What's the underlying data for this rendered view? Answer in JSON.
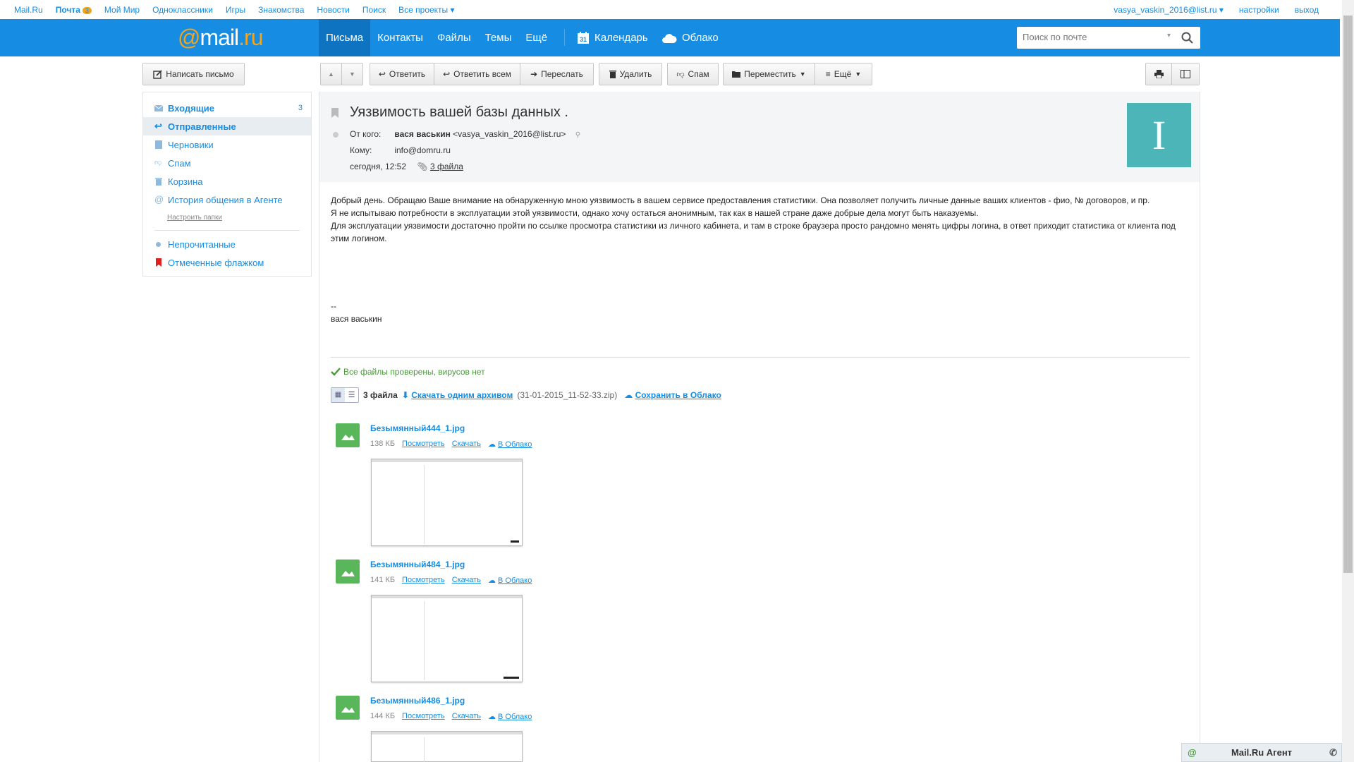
{
  "topbar": {
    "links": [
      "Mail.Ru",
      "Почта",
      "Мой Мир",
      "Одноклассники",
      "Игры",
      "Знакомства",
      "Новости",
      "Поиск",
      "Все проекты"
    ],
    "mail_count": "3",
    "user": "vasya_vaskin_2016@list.ru",
    "settings": "настройки",
    "logout": "выход"
  },
  "nav": {
    "logo_at": "@",
    "logo_mail": "mail",
    "logo_ru": ".ru",
    "tabs": [
      "Письма",
      "Контакты",
      "Файлы",
      "Темы",
      "Ещё"
    ],
    "calendar": "Календарь",
    "calendar_day": "31",
    "cloud": "Облако",
    "search_placeholder": "Поиск по почте"
  },
  "toolbar": {
    "compose": "Написать письмо",
    "reply": "Ответить",
    "reply_all": "Ответить всем",
    "forward": "Переслать",
    "delete": "Удалить",
    "spam": "Спам",
    "move": "Переместить",
    "more": "Ещё"
  },
  "sidebar": {
    "items": [
      {
        "label": "Входящие",
        "count": "3"
      },
      {
        "label": "Отправленные"
      },
      {
        "label": "Черновики"
      },
      {
        "label": "Спам"
      },
      {
        "label": "Корзина"
      },
      {
        "label": "История общения в Агенте"
      }
    ],
    "setup": "Настроить папки",
    "unread": "Непрочитанные",
    "flagged": "Отмеченные флажком"
  },
  "message": {
    "subject": "Уязвимость вашей базы данных .",
    "from_label": "От кого:",
    "from_name": "вася васькин",
    "from_email": "<vasya_vaskin_2016@list.ru>",
    "to_label": "Кому:",
    "to": "info@domru.ru",
    "date": "сегодня, 12:52",
    "files_link": "3 файла",
    "avatar_letter": "I",
    "body": [
      "Добрый день. Обращаю Ваше внимание на обнаруженную мною уязвимость в вашем сервисе предоставления статистики. Она позволяет получить личные данные ваших клиентов - фио, № договоров, и пр.",
      "Я не испытываю потребности в эксплуатации этой уязвимости, однако хочу остаться анонимным, так как в нашей стране даже добрые дела могут быть наказуемы.",
      "Для эксплуатации уязвимости достаточно пройти по ссылке просмотра статистики из личного кабинета, и там в строке браузера просто рандомно менять цифры логина, в ответ приходит статистика от клиента под этим логином."
    ],
    "sig_dash": "--",
    "signature": "вася васькин"
  },
  "attachments": {
    "virus_check": "Все файлы проверены, вирусов нет",
    "count": "3 файла",
    "download_all": "Скачать одним архивом",
    "archive_name": "(31-01-2015_11-52-33.zip)",
    "save_cloud": "Сохранить в Облако",
    "view": "Посмотреть",
    "download": "Скачать",
    "to_cloud": "В Облако",
    "files": [
      {
        "name": "Безымянный444_1.jpg",
        "size": "138 КБ"
      },
      {
        "name": "Безымянный484_1.jpg",
        "size": "141 КБ"
      },
      {
        "name": "Безымянный486_1.jpg",
        "size": "144 КБ"
      }
    ]
  },
  "agent": "Mail.Ru Агент",
  "colors": {
    "brand": "#168de2",
    "accent": "#f2a41c",
    "avatar": "#4bb5b8"
  }
}
